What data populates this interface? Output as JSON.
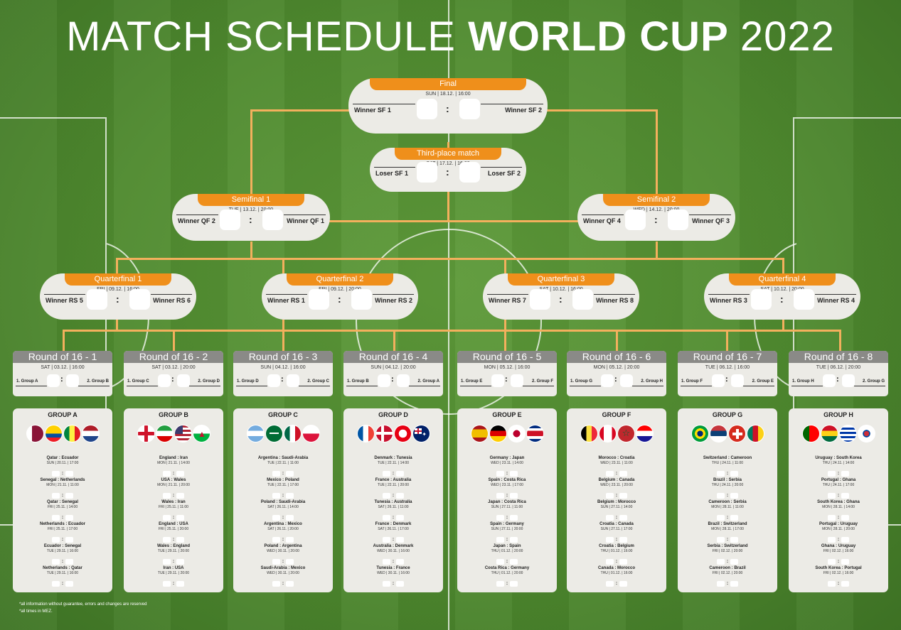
{
  "title": {
    "light": "MATCH SCHEDULE",
    "bold": "WORLD CUP",
    "year": "2022"
  },
  "colors": {
    "orange": "#ef8f1b",
    "connector": "#f3b05d",
    "grass": "#4f8a2f",
    "card": "#ecebe6",
    "r16_header": "#8a8a87"
  },
  "final": {
    "label": "Final",
    "when": "SUN | 18.12. | 16:00",
    "home": "Winner SF 1",
    "away": "Winner SF 2"
  },
  "third": {
    "label": "Third-place match",
    "when": "SAT | 17.12. | 16:00",
    "home": "Loser SF 1",
    "away": "Loser SF 2"
  },
  "semis": [
    {
      "label": "Semifinal 1",
      "when": "TUE | 13.12. | 20:00",
      "home": "Winner QF 2",
      "away": "Winner QF 1"
    },
    {
      "label": "Semifinal 2",
      "when": "WED | 14.12. | 20:00",
      "home": "Winner QF 4",
      "away": "Winner QF 3"
    }
  ],
  "quarters": [
    {
      "label": "Quarterfinal 1",
      "when": "FRI | 09.12. | 16:00",
      "home": "Winner RS 5",
      "away": "Winner RS 6"
    },
    {
      "label": "Quarterfinal 2",
      "when": "FRI | 09.12. | 20:00",
      "home": "Winner RS 1",
      "away": "Winner RS 2"
    },
    {
      "label": "Quarterfinal 3",
      "when": "SAT | 10.12. | 16:00",
      "home": "Winner RS 7",
      "away": "Winner RS 8"
    },
    {
      "label": "Quarterfinal 4",
      "when": "SAT | 10.12. | 20:00",
      "home": "Winner RS 3",
      "away": "Winner RS 4"
    }
  ],
  "r16": [
    {
      "label": "Round of 16 - 1",
      "when": "SAT  |  03.12.  |  16:00",
      "home": "1. Group A",
      "away": "2. Group B"
    },
    {
      "label": "Round of 16 - 2",
      "when": "SAT  |  03.12.  |  20:00",
      "home": "1. Group C",
      "away": "2. Group D"
    },
    {
      "label": "Round of 16 - 3",
      "when": "SUN  |  04.12.  |  16:00",
      "home": "1. Group D",
      "away": "2. Group C"
    },
    {
      "label": "Round of 16 - 4",
      "when": "SUN  |  04.12.  |  20:00",
      "home": "1. Group B",
      "away": "2. Group A"
    },
    {
      "label": "Round of 16 - 5",
      "when": "MON  |  05.12.  |  16:00",
      "home": "1. Group E",
      "away": "2. Group F"
    },
    {
      "label": "Round of 16 - 6",
      "when": "MON  |  05.12.  |  20:00",
      "home": "1. Group G",
      "away": "2. Group H"
    },
    {
      "label": "Round of 16 - 7",
      "when": "TUE  |  06.12.  |  16:00",
      "home": "1. Group F",
      "away": "2. Group E"
    },
    {
      "label": "Round of 16 - 8",
      "when": "TUE  |  06.12.  |  20:00",
      "home": "1. Group H",
      "away": "2. Group G"
    }
  ],
  "groups": [
    {
      "name": "GROUP A",
      "flags": [
        "qatar-flag",
        "ecuador-flag",
        "senegal-flag",
        "netherlands-flag"
      ],
      "matches": [
        {
          "teams": "Qatar  :  Ecuador",
          "when": "SUN  |  20.11.  |  17:00"
        },
        {
          "teams": "Senegal  :  Netherlands",
          "when": "MON  |  21.11.  |  11:00"
        },
        {
          "teams": "Qatar  :  Senegal",
          "when": "FRI  |  25.11.  |  14:00"
        },
        {
          "teams": "Netherlands  :  Ecuador",
          "when": "FRI  |  25.11.  |  17:00"
        },
        {
          "teams": "Ecuador  :  Senegal",
          "when": "TUE  |  29.11.  |  16:00"
        },
        {
          "teams": "Netherlands  :  Qatar",
          "when": "TUE  |  29.11.  |  16:00"
        }
      ]
    },
    {
      "name": "GROUP B",
      "flags": [
        "england-flag",
        "iran-flag",
        "usa-flag",
        "wales-flag"
      ],
      "matches": [
        {
          "teams": "England  :  Iran",
          "when": "MON  |  21.11.  |  14:00"
        },
        {
          "teams": "USA  :  Wales",
          "when": "MON  |  21.11.  |  20:00"
        },
        {
          "teams": "Wales  :  Iran",
          "when": "FRI  |  25.11.  |  11:00"
        },
        {
          "teams": "England  :  USA",
          "when": "FRI  |  25.11.  |  20:00"
        },
        {
          "teams": "Wales  :  England",
          "when": "TUE  |  29.11.  |  20:00"
        },
        {
          "teams": "Iran  :  USA",
          "when": "TUE  |  29.11.  |  20:00"
        }
      ]
    },
    {
      "name": "GROUP C",
      "flags": [
        "argentina-flag",
        "saudi-arabia-flag",
        "mexico-flag",
        "poland-flag"
      ],
      "matches": [
        {
          "teams": "Argentina  :  Saudi-Arabia",
          "when": "TUE  |  22.11.  |  11:00"
        },
        {
          "teams": "Mexico  :  Poland",
          "when": "TUE  |  22.11.  |  17:00"
        },
        {
          "teams": "Poland  :  Saudi-Arabia",
          "when": "SAT  |  26.11.  |  14:00"
        },
        {
          "teams": "Argentina  :  Mexico",
          "when": "SAT  |  26.11.  |  20:00"
        },
        {
          "teams": "Poland  :  Argentina",
          "when": "WED  |  30.11.  |  20:00"
        },
        {
          "teams": "Saudi-Arabia  :  Mexico",
          "when": "WED  |  30.11.  |  20:00"
        }
      ]
    },
    {
      "name": "GROUP D",
      "flags": [
        "france-flag",
        "denmark-flag",
        "tunisia-flag",
        "australia-flag"
      ],
      "matches": [
        {
          "teams": "Denmark  :  Tunesia",
          "when": "TUE  |  22.11.  |  14:00"
        },
        {
          "teams": "France  :  Australia",
          "when": "TUE  |  22.11.  |  20:00"
        },
        {
          "teams": "Tunesia  :  Australia",
          "when": "SAT  |  26.11.  |  11:00"
        },
        {
          "teams": "France  :  Denmark",
          "when": "SAT  |  26.11.  |  17:00"
        },
        {
          "teams": "Australia  :  Denmark",
          "when": "WED  |  30.11.  |  16:00"
        },
        {
          "teams": "Tunesia  :  France",
          "when": "WED  |  30.11.  |  16:00"
        }
      ]
    },
    {
      "name": "GROUP E",
      "flags": [
        "spain-flag",
        "germany-flag",
        "japan-flag",
        "costa-rica-flag"
      ],
      "matches": [
        {
          "teams": "Germany  :  Japan",
          "when": "WED  |  23.11.  |  14:00"
        },
        {
          "teams": "Spain  :  Costa Rica",
          "when": "WED  |  23.11.  |  17:00"
        },
        {
          "teams": "Japan  :  Costa Rica",
          "when": "SUN  |  27.11.  |  11:00"
        },
        {
          "teams": "Spain  :  Germany",
          "when": "SUN  |  27.11.  |  20:00"
        },
        {
          "teams": "Japan  :  Spain",
          "when": "THU  |  01.12.  |  20:00"
        },
        {
          "teams": "Costa Rica  :  Germany",
          "when": "THU  |  01.12.  |  20:00"
        }
      ]
    },
    {
      "name": "GROUP F",
      "flags": [
        "belgium-flag",
        "canada-flag",
        "morocco-flag",
        "croatia-flag"
      ],
      "matches": [
        {
          "teams": "Morocco  :  Croatia",
          "when": "WED  |  23.11.  |  11:00"
        },
        {
          "teams": "Belgium  :  Canada",
          "when": "WED  |  23.11.  |  20:00"
        },
        {
          "teams": "Belgium  :  Morocco",
          "when": "SUN  |  27.11.  |  14:00"
        },
        {
          "teams": "Croatia  :  Canada",
          "when": "SUN  |  27.11.  |  17:00"
        },
        {
          "teams": "Croatia  :  Belgium",
          "when": "THU  |  01.12.  |  16:00"
        },
        {
          "teams": "Canada  :  Morocco",
          "when": "THU  |  01.12.  |  16:00"
        }
      ]
    },
    {
      "name": "GROUP G",
      "flags": [
        "brazil-flag",
        "serbia-flag",
        "switzerland-flag",
        "cameroon-flag"
      ],
      "matches": [
        {
          "teams": "Switzerland  :  Cameroon",
          "when": "THU  |  24.11.  |  11:00"
        },
        {
          "teams": "Brazil  :  Serbia",
          "when": "THU  |  24.11.  |  20:00"
        },
        {
          "teams": "Cameroon  :  Serbia",
          "when": "MON  |  28.11.  |  11:00"
        },
        {
          "teams": "Brazil  :  Switzerland",
          "when": "MON  |  28.11.  |  17:00"
        },
        {
          "teams": "Serbia  :  Switzerland",
          "when": "FRI  |  02.12.  |  20:00"
        },
        {
          "teams": "Cameroon  :  Brazil",
          "when": "FRI  |  02.12.  |  20:00"
        }
      ]
    },
    {
      "name": "GROUP H",
      "flags": [
        "portugal-flag",
        "ghana-flag",
        "uruguay-flag",
        "south-korea-flag"
      ],
      "matches": [
        {
          "teams": "Uruguay  :  South Korea",
          "when": "THU  |  24.11.  |  14:00"
        },
        {
          "teams": "Portugal  :  Ghana",
          "when": "THU  |  24.11.  |  17:00"
        },
        {
          "teams": "South Korea  :  Ghana",
          "when": "MON  |  28.11.  |  14:00"
        },
        {
          "teams": "Portugal  :  Uruguay",
          "when": "MON  |  28.11.  |  20:00"
        },
        {
          "teams": "Ghana  :  Uruguay",
          "when": "FRI  |  02.12.  |  16:00"
        },
        {
          "teams": "South Korea  :  Portugal",
          "when": "FRI  |  02.12.  |  16:00"
        }
      ]
    }
  ],
  "notes": [
    "*all information without guarantee, errors and changes are reserved",
    "*all times in MEZ."
  ]
}
